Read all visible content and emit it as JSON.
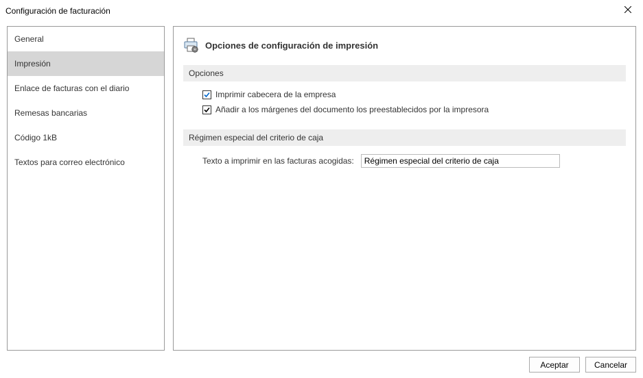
{
  "window": {
    "title": "Configuración de facturación"
  },
  "sidebar": {
    "items": [
      {
        "label": "General"
      },
      {
        "label": "Impresión"
      },
      {
        "label": "Enlace de facturas con el diario"
      },
      {
        "label": "Remesas bancarias"
      },
      {
        "label": "Código 1kB"
      },
      {
        "label": "Textos para correo electrónico"
      }
    ],
    "selected_index": 1
  },
  "main": {
    "heading": "Opciones de configuración de impresión",
    "sections": {
      "opciones": {
        "title": "Opciones",
        "checkboxes": [
          {
            "label": "Imprimir cabecera de la empresa",
            "checked": true,
            "color": "blue"
          },
          {
            "label": "Añadir a los márgenes del documento los preestablecidos por la impresora",
            "checked": true,
            "color": "black"
          }
        ]
      },
      "regimen": {
        "title": "Régimen especial del criterio de caja",
        "field_label": "Texto a imprimir en las facturas acogidas:",
        "field_value": "Régimen especial del criterio de caja"
      }
    }
  },
  "footer": {
    "accept": "Aceptar",
    "cancel": "Cancelar"
  }
}
